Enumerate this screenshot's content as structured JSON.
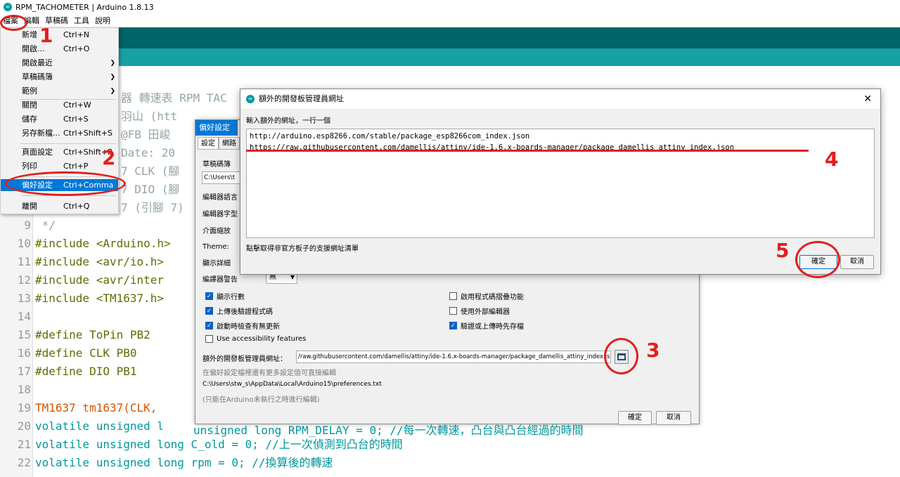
{
  "window": {
    "title": "RPM_TACHOMETER | Arduino 1.8.13"
  },
  "menubar": [
    "檔案",
    "編輯",
    "草稿碼",
    "工具",
    "說明"
  ],
  "file_menu": [
    {
      "label": "新增",
      "shortcut": "Ctrl+N"
    },
    {
      "label": "開啟...",
      "shortcut": "Ctrl+O"
    },
    {
      "label": "開啟最近",
      "shortcut": ""
    },
    {
      "label": "草稿碼簿",
      "shortcut": ""
    },
    {
      "label": "範例",
      "shortcut": ""
    },
    {
      "label": "關閉",
      "shortcut": "Ctrl+W"
    },
    {
      "label": "儲存",
      "shortcut": "Ctrl+S"
    },
    {
      "label": "另存新檔...",
      "shortcut": "Ctrl+Shift+S"
    },
    {
      "label": "頁面設定",
      "shortcut": "Ctrl+Shift+P"
    },
    {
      "label": "列印",
      "shortcut": "Ctrl+P"
    },
    {
      "label": "偏好設定",
      "shortcut": "Ctrl+Comma"
    },
    {
      "label": "離開",
      "shortcut": "Ctrl+Q"
    }
  ],
  "code": {
    "partial_lines": [
      "器 轉速表 RPM TAC",
      "羽山 (htt",
      "@FB 田峻",
      "Date: 20",
      "7 CLK (腳",
      "7 DIO (腳",
      "7 (引腳 7)"
    ],
    "lines": [
      {
        "n": "9",
        "text": " */"
      },
      {
        "n": "10",
        "text": "#include <Arduino.h>"
      },
      {
        "n": "11",
        "text": "#include <avr/io.h>"
      },
      {
        "n": "12",
        "text": "#include <avr/inter"
      },
      {
        "n": "13",
        "text": "#include <TM1637.h>"
      },
      {
        "n": "14",
        "text": ""
      },
      {
        "n": "15",
        "text": "#define ToPin PB2"
      },
      {
        "n": "16",
        "text": "#define CLK PB0"
      },
      {
        "n": "17",
        "text": "#define DIO PB1"
      },
      {
        "n": "18",
        "text": ""
      },
      {
        "n": "19",
        "text": "TM1637 tm1637(CLK,"
      },
      {
        "n": "20",
        "text": "volatile unsigned l"
      },
      {
        "n": "21",
        "text": "volatile unsigned long C_old = 0; //上一次偵測到凸台的時間"
      },
      {
        "n": "22",
        "text": "volatile unsigned long rpm = 0; //換算後的轉速"
      }
    ],
    "under_line20": "unsigned long RPM_DELAY = 0; //每一次轉速，凸台與凸台經過的時間"
  },
  "preferences": {
    "title": "偏好設定",
    "tabs": [
      "設定",
      "網路"
    ],
    "sketchbook_label": "草稿碼簿",
    "sketchbook_value": "C:\\Users\\t",
    "rows": [
      "編輯器語言",
      "編輯器字型",
      "介面縮放",
      "Theme:",
      "顯示詳細",
      "編譯器警告"
    ],
    "compiler_warning_value": "無",
    "checkboxes_left": [
      {
        "label": "顯示行數",
        "checked": true
      },
      {
        "label": "上傳後驗證程式碼",
        "checked": true
      },
      {
        "label": "啟動時檢查有無更新",
        "checked": true
      },
      {
        "label": "Use accessibility features",
        "checked": false
      }
    ],
    "checkboxes_right": [
      {
        "label": "啟用程式碼摺疊功能",
        "checked": false
      },
      {
        "label": "使用外部編輯器",
        "checked": false
      },
      {
        "label": "驗證或上傳時先存檔",
        "checked": true
      }
    ],
    "urls_label": "額外的開發板管理員網址：",
    "urls_value": "/raw.githubusercontent.com/damellis/attiny/ide-1.6.x-boards-manager/package_damellis_attiny_index.json",
    "note1": "在偏好設定檔裡還有更多設定值可直接編輯",
    "path": "C:\\Users\\stw_s\\AppData\\Local\\Arduino15\\preferences.txt",
    "note2": "(只能在Arduino未執行之時進行編輯)",
    "ok": "確定",
    "cancel": "取消"
  },
  "urls_dialog": {
    "title": "額外的開發板管理員網址",
    "instruction": "輸入額外的網址，一行一個",
    "content": "http://arduino.esp8266.com/stable/package_esp8266com_index.json\nhttps://raw.githubusercontent.com/damellis/attiny/ide-1.6.x-boards-manager/package_damellis_attiny_index.json",
    "link": "點擊取得非官方板子的支援網址清單",
    "ok": "確定",
    "cancel": "取消",
    "close": "✕"
  },
  "annotations": [
    "1",
    "2",
    "3",
    "4",
    "5"
  ],
  "colors": {
    "accent": "#e0201e",
    "teal_dark": "#006468",
    "teal_light": "#17a1a5",
    "selection": "#0078d7"
  }
}
